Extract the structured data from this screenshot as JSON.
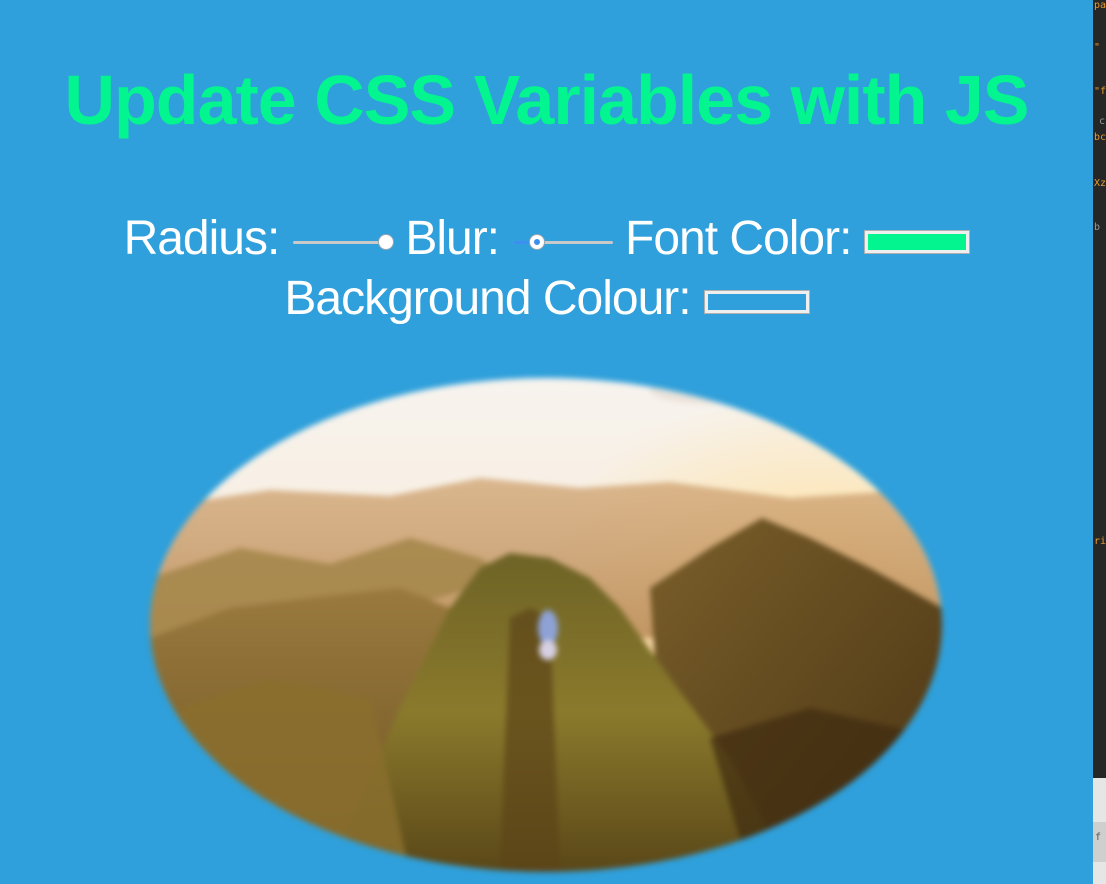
{
  "page": {
    "title": "Update CSS Variables with JS"
  },
  "controls": {
    "radius": {
      "label": "Radius:",
      "value_fraction": 0.95
    },
    "blur": {
      "label": "Blur:",
      "value_fraction": 0.25
    },
    "font_color": {
      "label": "Font Color:",
      "value": "#03f58f"
    },
    "background_colour": {
      "label": "Background Colour:",
      "value": "#2fa0db"
    }
  },
  "image": {
    "alt": "blurred mountain ridge landscape"
  },
  "devtools_fragments": [
    "pa",
    "\"",
    "\"f",
    "c",
    "bc",
    "Xz",
    "b",
    "ri",
    "f"
  ]
}
